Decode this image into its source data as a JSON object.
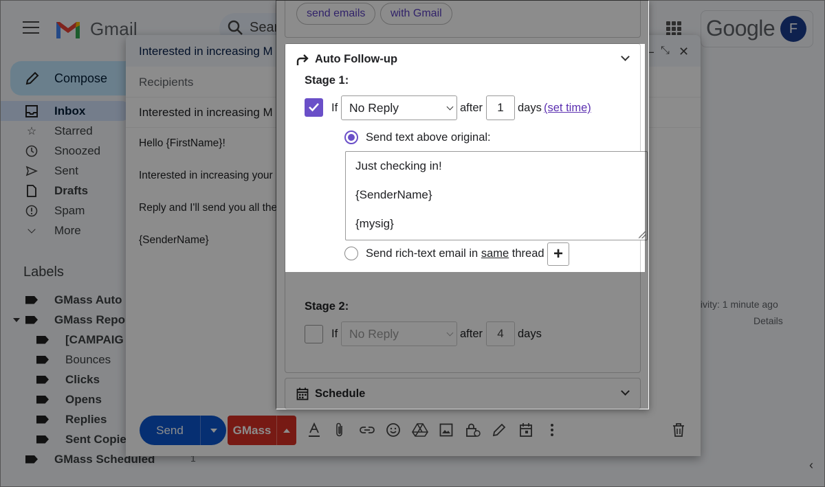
{
  "gmail": {
    "logo_text": "Gmail",
    "search_placeholder": "Sear",
    "google_text": "Google",
    "avatar_initial": "F",
    "compose_label": "Compose",
    "nav": [
      {
        "label": "Inbox",
        "icon": "inbox-icon"
      },
      {
        "label": "Starred",
        "icon": "star-icon"
      },
      {
        "label": "Snoozed",
        "icon": "clock-icon"
      },
      {
        "label": "Sent",
        "icon": "send-icon"
      },
      {
        "label": "Drafts",
        "icon": "draft-icon"
      },
      {
        "label": "Spam",
        "icon": "spam-icon"
      },
      {
        "label": "More",
        "icon": "chevron-down-icon"
      }
    ],
    "labels_title": "Labels",
    "labels": [
      "GMass Auto",
      "GMass Repo",
      "[CAMPAIG",
      "Bounces",
      "Clicks",
      "Opens",
      "Replies",
      "Sent Copie",
      "GMass Scheduled"
    ],
    "label_count": "1",
    "activity_text": "tivity: 1 minute ago",
    "details_text": "Details"
  },
  "compose": {
    "title": "Interested in increasing M",
    "recipients": "Recipients",
    "subject": "Interested in increasing M",
    "body_lines": [
      "Hello {FirstName}!",
      "Interested in increasing your",
      "Reply and I'll send you all the",
      "{SenderName}"
    ],
    "send_label": "Send",
    "gmass_label": "GMass"
  },
  "gmass_panel": {
    "chips": [
      "send emails",
      "with Gmail"
    ],
    "auto_followup_title": "Auto Follow-up",
    "stage1": {
      "label": "Stage 1:",
      "checked": true,
      "if_label": "If",
      "condition": "No Reply",
      "after_label": "after",
      "days_value": "1",
      "days_label": "days",
      "set_time_link": "(set time)",
      "option_above": "Send text above original:",
      "message_lines": [
        "Just checking in!",
        "{SenderName}",
        "{mysig}"
      ],
      "option_rich_prefix": "Send rich-text email in ",
      "option_rich_same": "same",
      "option_rich_suffix": " thread",
      "add_label": "+"
    },
    "stage2": {
      "label": "Stage 2:",
      "checked": false,
      "if_label": "If",
      "condition": "No Reply",
      "after_label": "after",
      "days_value": "4",
      "days_label": "days"
    },
    "schedule_title": "Schedule"
  },
  "colors": {
    "accent": "#6a4fc8",
    "send_blue": "#0b57d0",
    "gmass_red": "#d93025"
  }
}
